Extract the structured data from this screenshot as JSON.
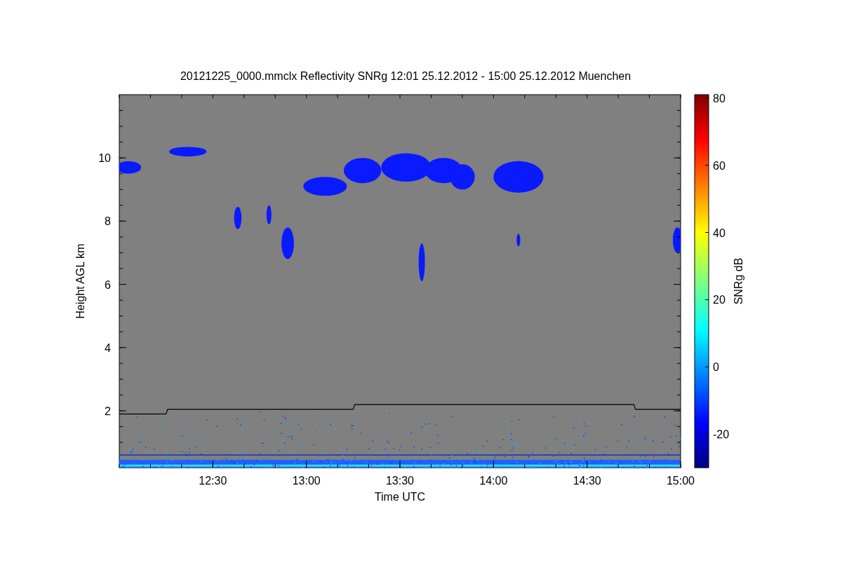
{
  "plot": {
    "title": "20121225_0000.mmclx Reflectivity SNRg   12:01 25.12.2012 - 15:00 25.12.2012 Muenchen",
    "xlabel": "Time UTC",
    "ylabel": "Height AGL km",
    "xticks": [
      "12:30",
      "13:00",
      "13:30",
      "14:00",
      "14:30",
      "15:00"
    ],
    "yticks": [
      "10",
      "8",
      "6",
      "4",
      "2"
    ],
    "colorbar": {
      "label": "SNRg dB",
      "ticks": [
        "80",
        "60",
        "40",
        "20",
        "0",
        "-20"
      ]
    }
  }
}
